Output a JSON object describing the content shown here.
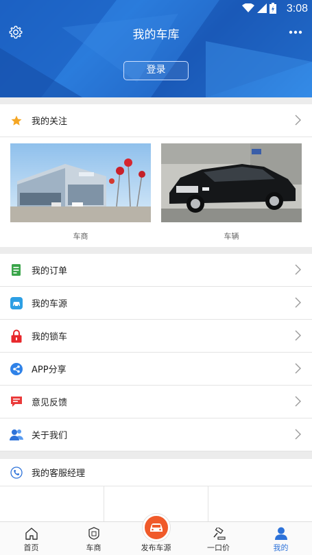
{
  "status_bar": {
    "time": "3:08"
  },
  "header": {
    "title": "我的车库",
    "login_label": "登录"
  },
  "follow": {
    "label": "我的关注",
    "photos": [
      {
        "caption": "车商"
      },
      {
        "caption": "车辆"
      }
    ]
  },
  "menu": [
    {
      "label": "我的订单",
      "icon": "order-icon"
    },
    {
      "label": "我的车源",
      "icon": "car-source-icon"
    },
    {
      "label": "我的锁车",
      "icon": "lock-icon"
    },
    {
      "label": "APP分享",
      "icon": "share-icon"
    },
    {
      "label": "意见反馈",
      "icon": "feedback-icon"
    },
    {
      "label": "关于我们",
      "icon": "about-icon"
    }
  ],
  "service": {
    "label": "我的客服经理"
  },
  "bottom_nav": [
    {
      "label": "首页"
    },
    {
      "label": "车商"
    },
    {
      "label": "发布车源"
    },
    {
      "label": "一口价"
    },
    {
      "label": "我的"
    }
  ],
  "colors": {
    "header_blue": "#2a7fe0",
    "accent_blue": "#2d72d9",
    "publish_orange": "#f05a2a"
  }
}
